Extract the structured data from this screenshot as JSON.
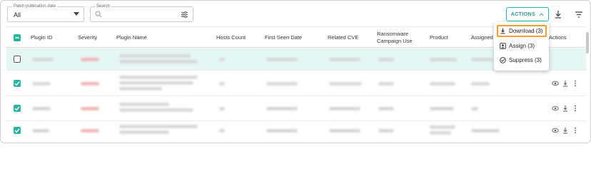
{
  "filters": {
    "patch_date": {
      "label": "Patch publication date",
      "value": "All"
    },
    "search": {
      "label": "Search",
      "placeholder": ""
    }
  },
  "toolbar": {
    "actions_label": "ACTIONS"
  },
  "menu": {
    "items": [
      {
        "label": "Download (3)",
        "icon": "download-icon"
      },
      {
        "label": "Assign (3)",
        "icon": "assign-icon"
      },
      {
        "label": "Suppress (3)",
        "icon": "suppress-icon"
      }
    ]
  },
  "table": {
    "columns": [
      "Plugin ID",
      "Severity",
      "Plugin Name",
      "Hosts Count",
      "First Seen Date",
      "Related CVE",
      "Ransomware Campaign Use",
      "Product",
      "Assigned",
      "Actions"
    ],
    "rows": [
      {
        "selected": false,
        "highlighted": true
      },
      {
        "selected": true,
        "highlighted": false
      },
      {
        "selected": true,
        "highlighted": false
      },
      {
        "selected": true,
        "highlighted": false
      }
    ]
  },
  "colors": {
    "accent": "#2bb3a2",
    "focus": "#f0a02a",
    "row_highlight": "#e5f6f4"
  }
}
